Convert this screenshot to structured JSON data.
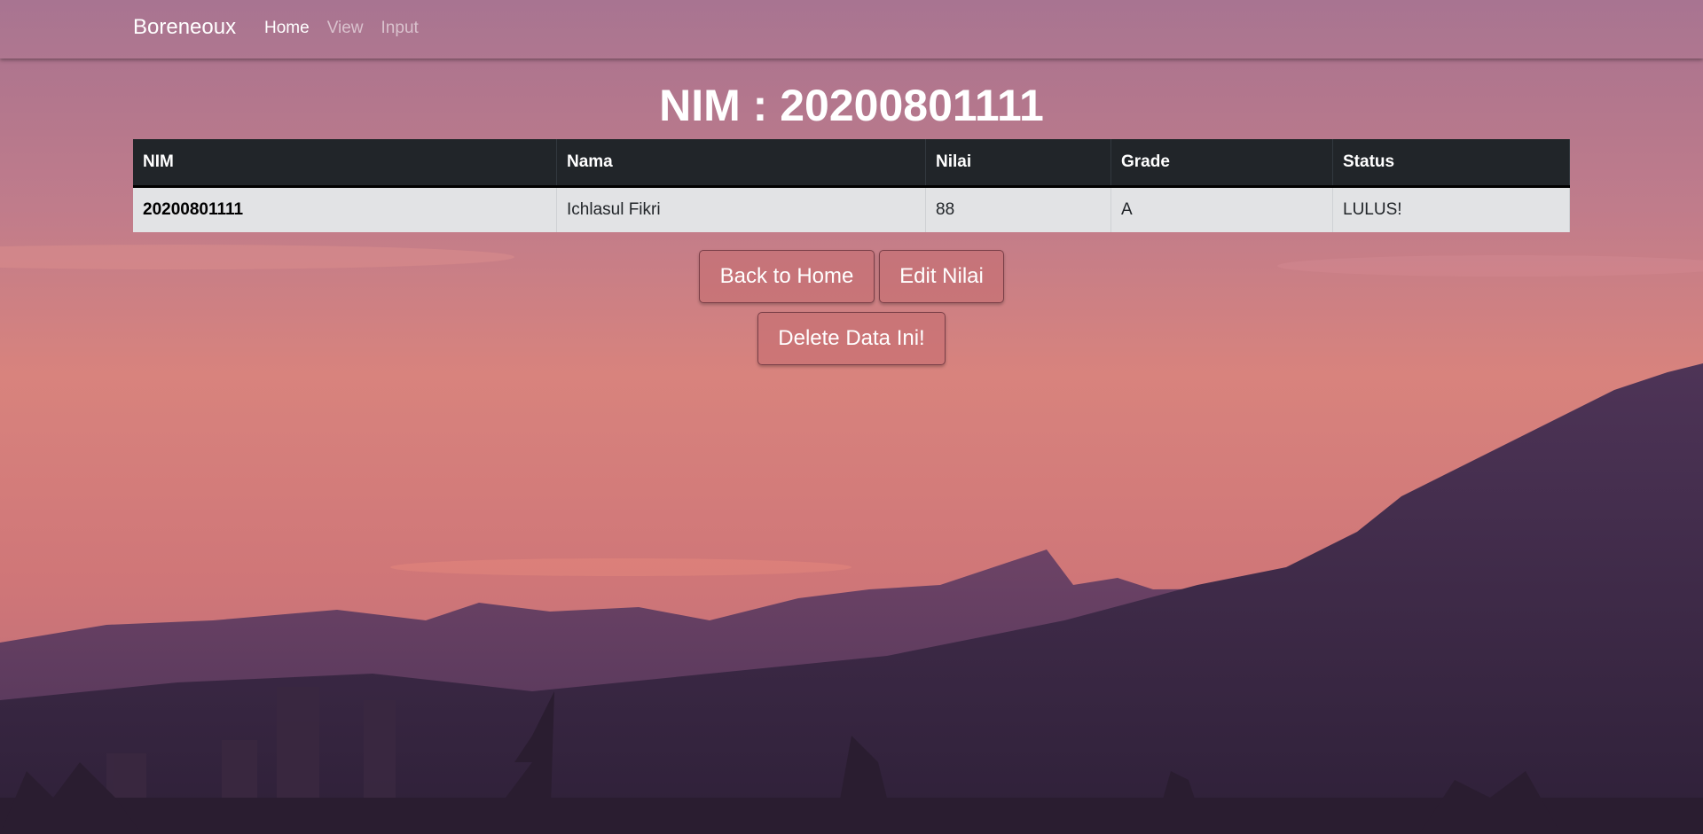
{
  "nav": {
    "brand": "Boreneoux",
    "links": [
      {
        "label": "Home",
        "active": true
      },
      {
        "label": "View",
        "active": false
      },
      {
        "label": "Input",
        "active": false
      }
    ]
  },
  "page": {
    "title": "NIM : 20200801111"
  },
  "table": {
    "headers": [
      "NIM",
      "Nama",
      "Nilai",
      "Grade",
      "Status"
    ],
    "rows": [
      [
        "20200801111",
        "Ichlasul Fikri",
        "88",
        "A",
        "LULUS!"
      ]
    ]
  },
  "actions": {
    "back_label": "Back to Home",
    "edit_label": "Edit Nilai",
    "delete_label": "Delete Data Ini!"
  },
  "colors": {
    "table_header": "#212529",
    "table_row": "#e2e3e5",
    "button_bg": "#c46b70"
  }
}
